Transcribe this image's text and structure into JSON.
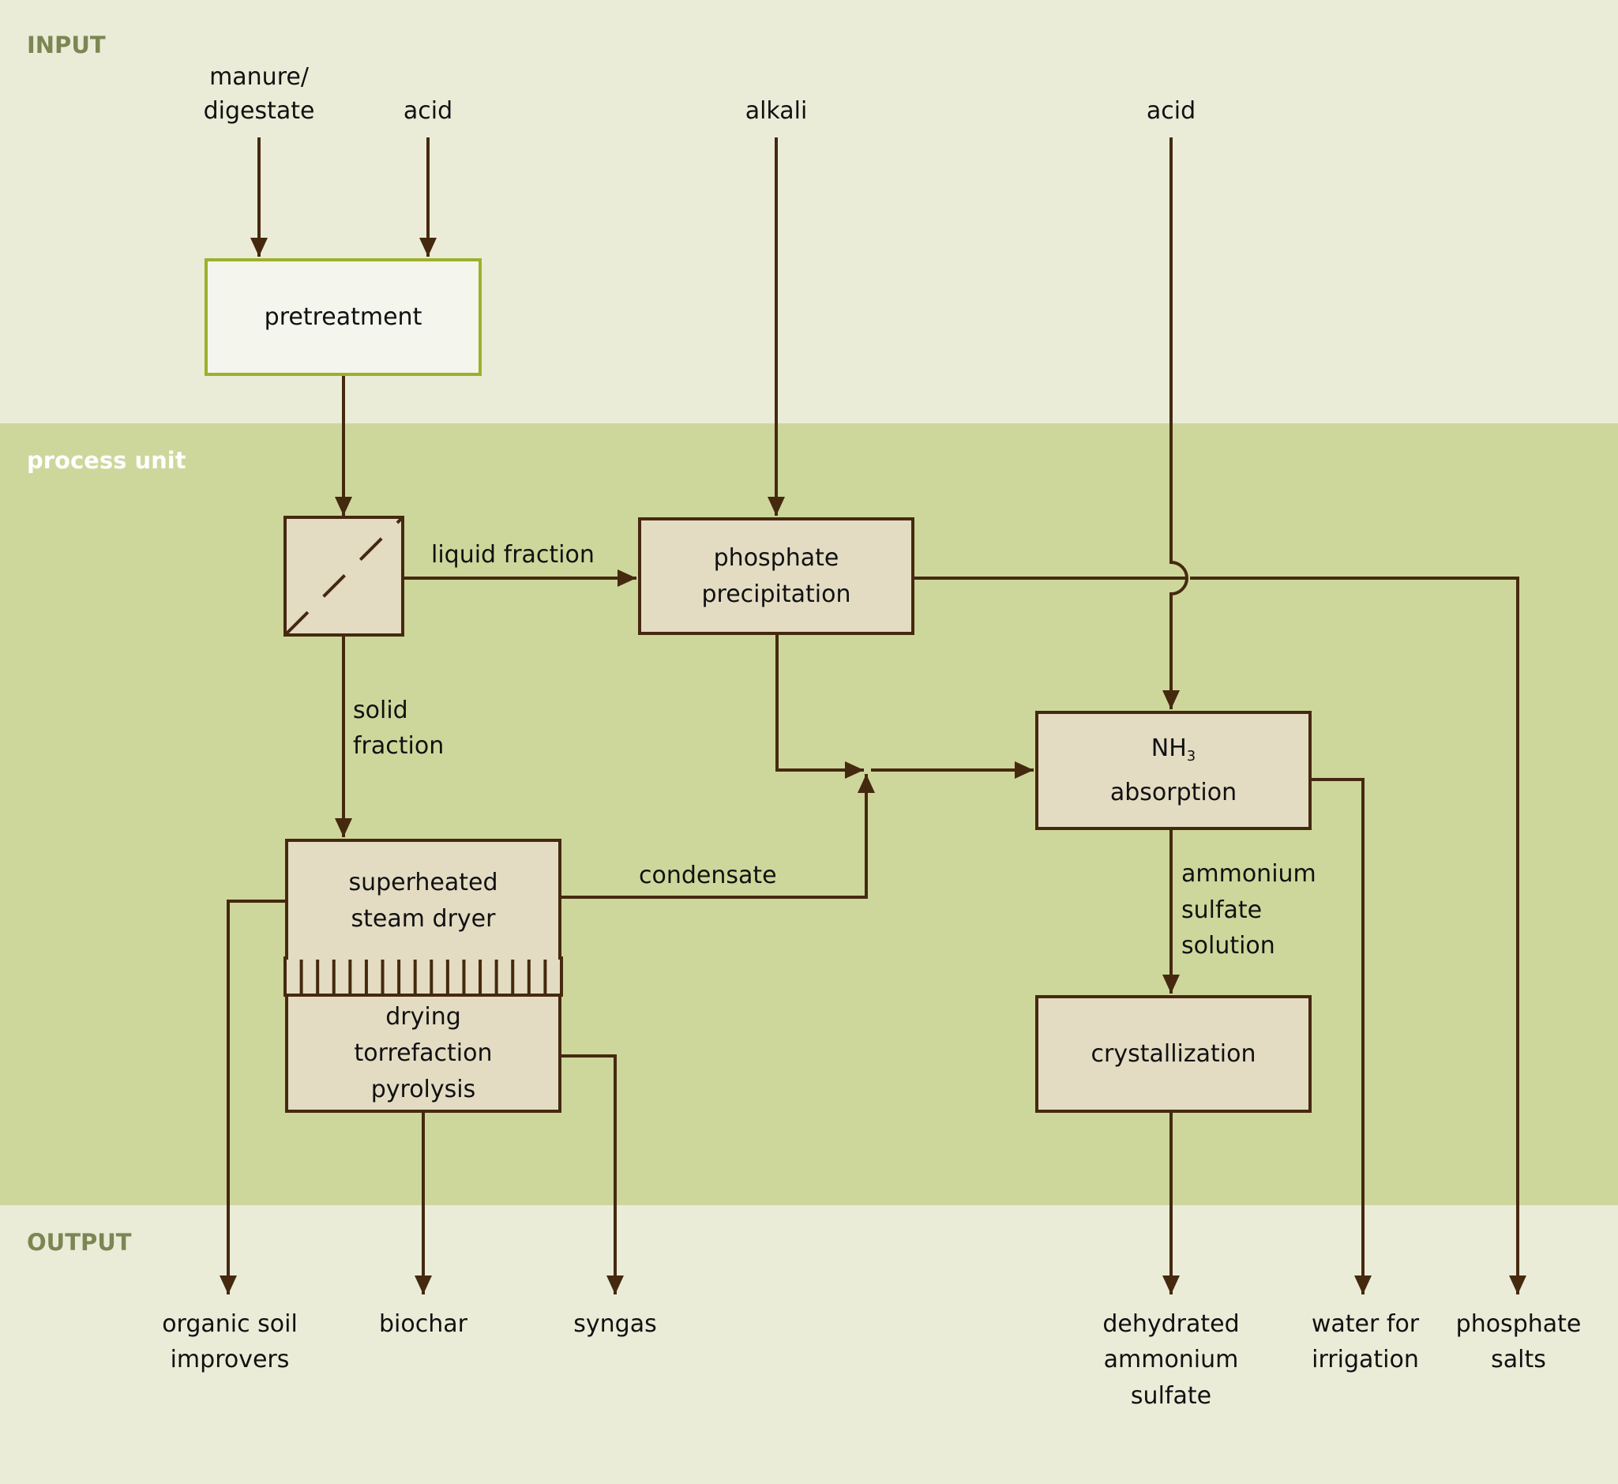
{
  "sections": {
    "input": "INPUT",
    "process": "process unit",
    "output": "OUTPUT"
  },
  "inputs": {
    "manure_line1": "manure/",
    "manure_line2": "digestate",
    "acid_1": "acid",
    "alkali": "alkali",
    "acid_2": "acid"
  },
  "process_boxes": {
    "pretreatment": "pretreatment",
    "separator_icon": "solid-liquid-separator-icon",
    "phosphate_line1": "phosphate",
    "phosphate_line2": "precipitation",
    "nh3_main": "NH",
    "nh3_sub": "3",
    "nh3_line2": "absorption",
    "dryer_line1": "superheated",
    "dryer_line2": "steam dryer",
    "thermal_line1": "drying",
    "thermal_line2": "torrefaction",
    "thermal_line3": "pyrolysis",
    "crystallization": "crystallization"
  },
  "flow_labels": {
    "liquid_fraction": "liquid fraction",
    "solid_line1": "solid",
    "solid_line2": "fraction",
    "condensate": "condensate",
    "ammonium_line1": "ammonium",
    "ammonium_line2": "sulfate",
    "ammonium_line3": "solution"
  },
  "outputs": {
    "organic_line1": "organic soil",
    "organic_line2": "improvers",
    "biochar": "biochar",
    "syngas": "syngas",
    "dehydrated_line1": "dehydrated",
    "dehydrated_line2": "ammonium",
    "dehydrated_line3": "sulfate",
    "water_line1": "water for",
    "water_line2": "irrigation",
    "phosphate_salts_line1": "phosphate",
    "phosphate_salts_line2": "salts"
  },
  "colors": {
    "input_bg": "#eaecd8",
    "process_bg": "#cdd79b",
    "box_fill": "#e3dcc3",
    "line": "#45290f",
    "pretreatment_border": "#9db02c",
    "pretreatment_fill": "#f4f5ec",
    "section_label": "#7c8653"
  }
}
